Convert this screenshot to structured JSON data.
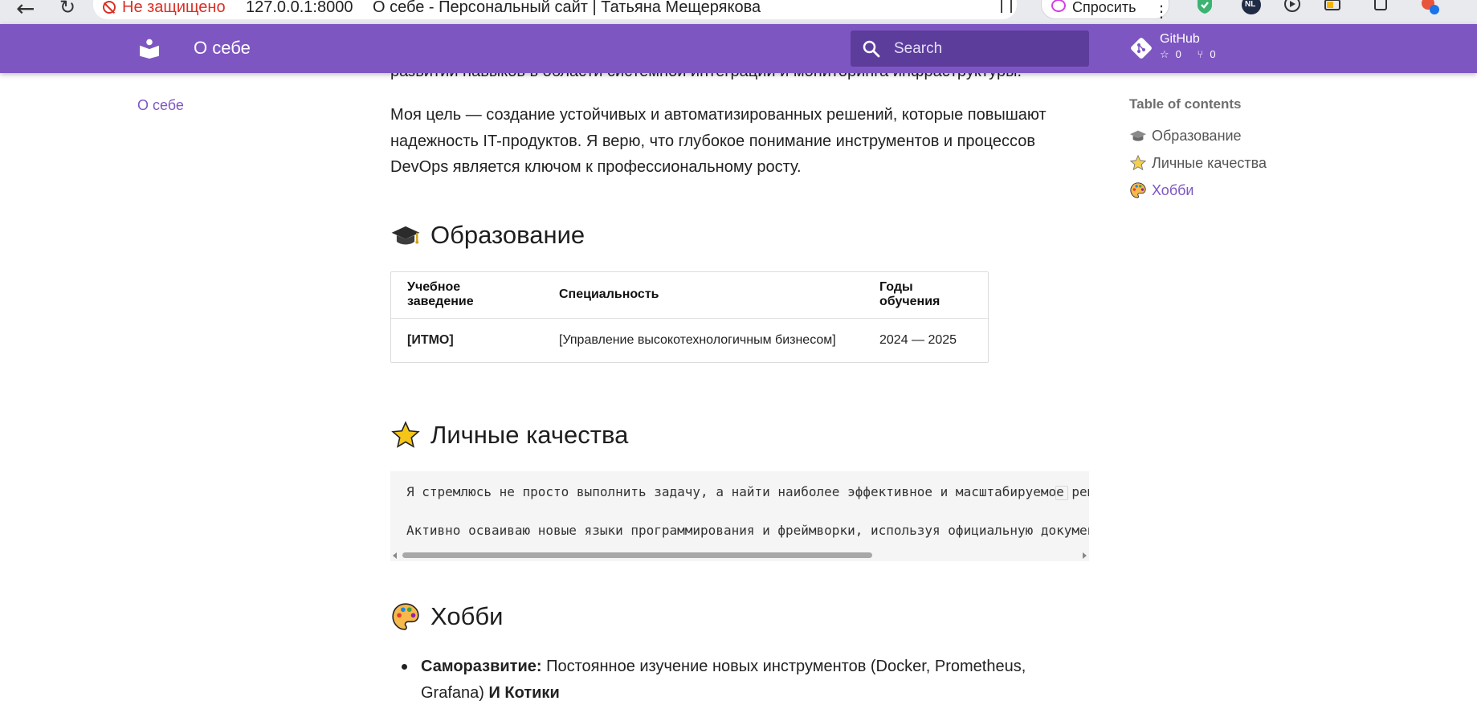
{
  "browser": {
    "security_label": "Не защищено",
    "url": "127.0.0.1:8000",
    "tab_title": "О себе - Персональный сайт | Татьяна Мещерякова",
    "ask_label": "Спросить",
    "ext_badge": "NL"
  },
  "header": {
    "title": "О себе",
    "search_placeholder": "Search",
    "repo_name": "GitHub",
    "stars": "0",
    "forks": "0",
    "accent": "#7e56c2"
  },
  "left_nav": {
    "items": [
      "О себе"
    ]
  },
  "toc": {
    "title": "Table of contents",
    "items": [
      "Образование",
      "Личные качества",
      "Хобби"
    ]
  },
  "content": {
    "intro_cut": "развитии навыков в области системной интеграции и мониторинга инфраструктуры.",
    "goal_paragraph": "Моя цель — создание устойчивых и автоматизированных решений, которые повышают надежность IT-продуктов. Я верю, что глубокое понимание инструментов и процессов DevOps является ключом к профессиональному росту.",
    "education_heading": "Образование",
    "table": {
      "headers": [
        "Учебное заведение",
        "Специальность",
        "Годы обучения"
      ],
      "rows": [
        [
          "[ИТМО]",
          "[Управление высокотехнологичным бизнесом]",
          "2024 — 2025"
        ]
      ]
    },
    "qualities_heading": "Личные качества",
    "code_lines": [
      "Я стремлюсь не просто выполнить задачу, а найти наиболее эффективное и масштабируемое решение.",
      "Активно осваиваю новые языки программирования и фреймворки, используя официальную документацию."
    ],
    "hobby_heading": "Хобби",
    "hobby_items": [
      {
        "label": "Саморазвитие:",
        "text": " Постоянное изучение новых инструментов (Docker, Prometheus, Grafana) ",
        "tail": "И Котики"
      }
    ]
  }
}
